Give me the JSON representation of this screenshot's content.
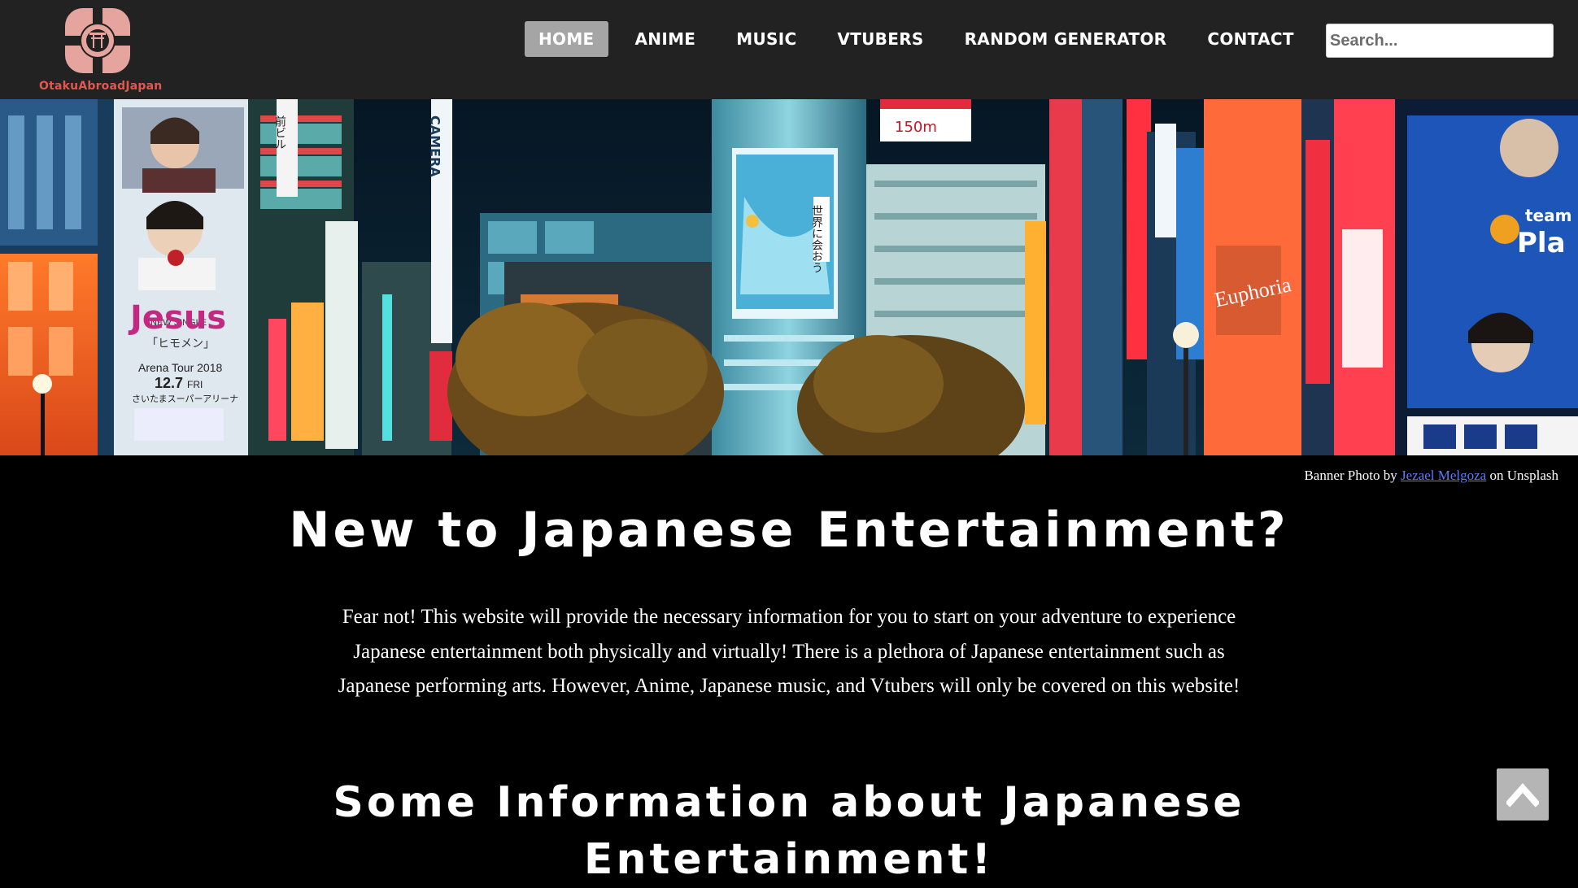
{
  "brand": {
    "name": "OtakuAbroadJapan"
  },
  "nav": {
    "items": [
      {
        "label": "HOME",
        "active": true
      },
      {
        "label": "ANIME",
        "active": false
      },
      {
        "label": "MUSIC",
        "active": false
      },
      {
        "label": "VTUBERS",
        "active": false
      },
      {
        "label": "RANDOM GENERATOR",
        "active": false
      },
      {
        "label": "CONTACT",
        "active": false
      }
    ]
  },
  "search": {
    "placeholder": "Search..."
  },
  "banner": {
    "signs": {
      "jesus": "Jesus",
      "single": "NEW SINGLE",
      "himen": "「ヒモメン」",
      "tour": "Arena Tour 2018",
      "date": "12.7",
      "day": "FRI",
      "arena": "さいたまスーパーアリーナ",
      "distance": "150m",
      "camera": "CAMERA",
      "euphoria": "Euphoria",
      "team": "team",
      "play": "Pla",
      "mae": "前ビル",
      "sekai": "世界に会おう"
    }
  },
  "credit": {
    "prefix": "Banner Photo by ",
    "author": "Jezael Melgoza",
    "suffix": " on Unsplash"
  },
  "main": {
    "title": "New to Japanese Entertainment?",
    "intro": "Fear not! This website will provide the necessary information for you to start on your adventure to experience Japanese entertainment both physically and virtually! There is a plethora of Japanese entertainment such as Japanese performing arts. However, Anime, Japanese music, and Vtubers will only be covered on this website!",
    "section_title": "Some Information about Japanese Entertainment!"
  },
  "icons": {
    "logo": "torii-gate-logo-icon",
    "back_to_top": "chevron-up-icon"
  },
  "colors": {
    "header_bg": "#222222",
    "brand": "#e0584e",
    "active_nav": "#a5a5a5",
    "link": "#5a7dff"
  }
}
